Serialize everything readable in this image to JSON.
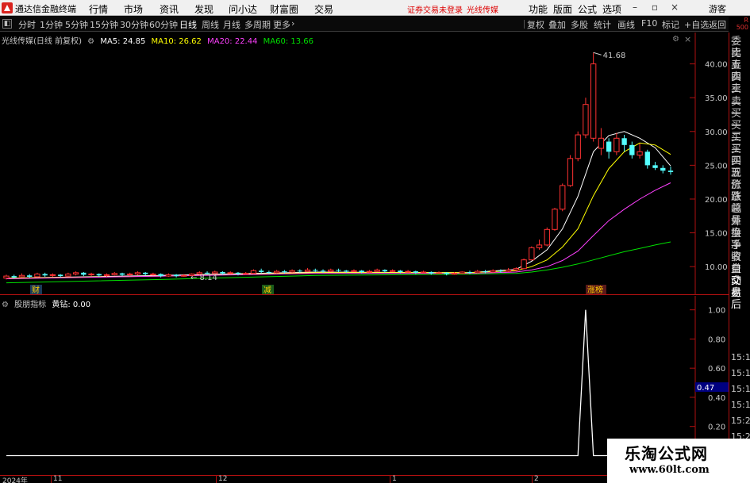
{
  "app": {
    "name": "通达信金融终端",
    "menus": [
      "行情",
      "市场",
      "资讯",
      "发现",
      "问小达",
      "财富圈",
      "交易"
    ],
    "notice": "证券交易未登录",
    "stock_tag": "光线传媒",
    "right_menus": [
      "功能",
      "版面",
      "公式",
      "选项"
    ],
    "guest": "游客"
  },
  "period_bar": {
    "periods": [
      "分时",
      "1分钟",
      "5分钟",
      "15分钟",
      "30分钟",
      "60分钟",
      "日线",
      "周线",
      "月线",
      "多周期",
      "更多"
    ],
    "active": "日线",
    "more_arrow": "›",
    "tools": [
      "复权",
      "叠加",
      "多股",
      "统计",
      "画线",
      "F10",
      "标记",
      "+自选",
      "返回"
    ]
  },
  "main_legend": {
    "title": "光线传媒(日线 前复权)",
    "ma5": "MA5: 24.85",
    "ma10": "MA10: 26.62",
    "ma20": "MA20: 22.44",
    "ma60": "MA60: 13.66",
    "colors": {
      "ma5": "#ffffff",
      "ma10": "#ffff00",
      "ma20": "#ff40ff",
      "ma60": "#00e000"
    }
  },
  "sub_legend": {
    "title": "股朋指标",
    "label": "黄钻: 0.00"
  },
  "chart_data": [
    {
      "type": "candlestick",
      "title": "光线传媒(日线 前复权)",
      "y_ticks": [
        "40.00",
        "35.00",
        "30.00",
        "25.00",
        "20.00",
        "15.00",
        "10.00"
      ],
      "ylim": [
        6.5,
        43
      ],
      "high_label": "41.68",
      "low_label": "8.14",
      "event_markers": [
        "财",
        "减",
        "涨榜"
      ],
      "candles": [
        {
          "o": 8.3,
          "c": 8.6,
          "h": 8.8,
          "l": 8.1
        },
        {
          "o": 8.6,
          "c": 8.4,
          "h": 8.8,
          "l": 8.2
        },
        {
          "o": 8.5,
          "c": 8.7,
          "h": 9.0,
          "l": 8.4
        },
        {
          "o": 8.7,
          "c": 8.5,
          "h": 8.9,
          "l": 8.3
        },
        {
          "o": 8.5,
          "c": 8.9,
          "h": 9.1,
          "l": 8.4
        },
        {
          "o": 8.9,
          "c": 8.7,
          "h": 9.1,
          "l": 8.5
        },
        {
          "o": 8.7,
          "c": 8.8,
          "h": 9.0,
          "l": 8.5
        },
        {
          "o": 8.8,
          "c": 8.6,
          "h": 8.9,
          "l": 8.4
        },
        {
          "o": 8.6,
          "c": 8.9,
          "h": 9.1,
          "l": 8.5
        },
        {
          "o": 8.9,
          "c": 9.1,
          "h": 9.3,
          "l": 8.7
        },
        {
          "o": 9.1,
          "c": 8.8,
          "h": 9.2,
          "l": 8.6
        },
        {
          "o": 8.8,
          "c": 8.9,
          "h": 9.1,
          "l": 8.6
        },
        {
          "o": 8.9,
          "c": 8.7,
          "h": 9.0,
          "l": 8.5
        },
        {
          "o": 8.7,
          "c": 8.8,
          "h": 9.0,
          "l": 8.5
        },
        {
          "o": 8.8,
          "c": 9.0,
          "h": 9.2,
          "l": 8.7
        },
        {
          "o": 9.0,
          "c": 8.8,
          "h": 9.1,
          "l": 8.6
        },
        {
          "o": 8.8,
          "c": 8.9,
          "h": 9.1,
          "l": 8.6
        },
        {
          "o": 8.9,
          "c": 9.1,
          "h": 9.3,
          "l": 8.7
        },
        {
          "o": 9.1,
          "c": 8.9,
          "h": 9.2,
          "l": 8.7
        },
        {
          "o": 8.9,
          "c": 8.9,
          "h": 9.1,
          "l": 8.7
        },
        {
          "o": 8.9,
          "c": 8.6,
          "h": 9.0,
          "l": 8.4
        },
        {
          "o": 8.6,
          "c": 8.8,
          "h": 9.0,
          "l": 8.5
        },
        {
          "o": 8.8,
          "c": 8.6,
          "h": 8.9,
          "l": 8.4
        },
        {
          "o": 8.6,
          "c": 8.7,
          "h": 8.9,
          "l": 8.5
        },
        {
          "o": 8.7,
          "c": 8.9,
          "h": 9.0,
          "l": 8.6
        },
        {
          "o": 8.9,
          "c": 9.1,
          "h": 9.3,
          "l": 8.8
        },
        {
          "o": 9.1,
          "c": 9.0,
          "h": 9.3,
          "l": 8.8
        },
        {
          "o": 9.0,
          "c": 9.2,
          "h": 9.4,
          "l": 8.9
        },
        {
          "o": 9.2,
          "c": 9.0,
          "h": 9.3,
          "l": 8.8
        },
        {
          "o": 9.0,
          "c": 9.1,
          "h": 9.3,
          "l": 8.9
        },
        {
          "o": 9.1,
          "c": 8.9,
          "h": 9.2,
          "l": 8.7
        },
        {
          "o": 8.9,
          "c": 9.0,
          "h": 9.2,
          "l": 8.8
        },
        {
          "o": 9.0,
          "c": 9.4,
          "h": 9.6,
          "l": 8.9
        },
        {
          "o": 9.4,
          "c": 9.2,
          "h": 9.7,
          "l": 9.0
        },
        {
          "o": 9.2,
          "c": 9.1,
          "h": 9.4,
          "l": 8.9
        },
        {
          "o": 9.1,
          "c": 9.3,
          "h": 9.5,
          "l": 9.0
        },
        {
          "o": 9.3,
          "c": 9.2,
          "h": 9.5,
          "l": 9.0
        },
        {
          "o": 9.2,
          "c": 9.4,
          "h": 9.6,
          "l": 9.1
        },
        {
          "o": 9.4,
          "c": 9.3,
          "h": 9.6,
          "l": 9.1
        },
        {
          "o": 9.3,
          "c": 9.5,
          "h": 9.8,
          "l": 9.2
        },
        {
          "o": 9.5,
          "c": 9.4,
          "h": 9.7,
          "l": 9.2
        },
        {
          "o": 9.4,
          "c": 9.3,
          "h": 9.6,
          "l": 9.1
        },
        {
          "o": 9.3,
          "c": 9.5,
          "h": 9.7,
          "l": 9.2
        },
        {
          "o": 9.5,
          "c": 9.4,
          "h": 9.7,
          "l": 9.2
        },
        {
          "o": 9.4,
          "c": 9.3,
          "h": 9.5,
          "l": 9.1
        },
        {
          "o": 9.3,
          "c": 9.4,
          "h": 9.6,
          "l": 9.2
        },
        {
          "o": 9.4,
          "c": 9.2,
          "h": 9.5,
          "l": 9.0
        },
        {
          "o": 9.2,
          "c": 9.3,
          "h": 9.5,
          "l": 9.1
        },
        {
          "o": 9.3,
          "c": 9.5,
          "h": 9.7,
          "l": 9.2
        },
        {
          "o": 9.5,
          "c": 9.3,
          "h": 9.6,
          "l": 9.1
        },
        {
          "o": 9.3,
          "c": 9.4,
          "h": 9.6,
          "l": 9.2
        },
        {
          "o": 9.4,
          "c": 9.2,
          "h": 9.5,
          "l": 9.0
        },
        {
          "o": 9.2,
          "c": 9.3,
          "h": 9.5,
          "l": 9.1
        },
        {
          "o": 9.3,
          "c": 9.1,
          "h": 9.4,
          "l": 8.9
        },
        {
          "o": 9.1,
          "c": 9.2,
          "h": 9.4,
          "l": 9.0
        },
        {
          "o": 9.2,
          "c": 9.0,
          "h": 9.3,
          "l": 8.8
        },
        {
          "o": 9.0,
          "c": 9.1,
          "h": 9.3,
          "l": 8.9
        },
        {
          "o": 9.1,
          "c": 8.9,
          "h": 9.2,
          "l": 8.7
        },
        {
          "o": 8.9,
          "c": 9.0,
          "h": 9.2,
          "l": 8.8
        },
        {
          "o": 9.0,
          "c": 9.2,
          "h": 9.3,
          "l": 8.9
        },
        {
          "o": 9.2,
          "c": 9.1,
          "h": 9.4,
          "l": 8.9
        },
        {
          "o": 9.1,
          "c": 9.3,
          "h": 9.5,
          "l": 9.0
        },
        {
          "o": 9.3,
          "c": 9.2,
          "h": 9.5,
          "l": 9.0
        },
        {
          "o": 9.2,
          "c": 9.4,
          "h": 9.6,
          "l": 9.1
        },
        {
          "o": 9.4,
          "c": 9.3,
          "h": 9.6,
          "l": 9.1
        },
        {
          "o": 9.3,
          "c": 9.5,
          "h": 9.8,
          "l": 9.2
        },
        {
          "o": 9.5,
          "c": 9.7,
          "h": 9.9,
          "l": 9.3
        },
        {
          "o": 9.7,
          "c": 11.0,
          "h": 11.2,
          "l": 9.6
        },
        {
          "o": 11.0,
          "c": 12.8,
          "h": 13.0,
          "l": 10.9
        },
        {
          "o": 12.8,
          "c": 13.2,
          "h": 14.0,
          "l": 12.5
        },
        {
          "o": 13.2,
          "c": 15.5,
          "h": 15.8,
          "l": 13.0
        },
        {
          "o": 15.5,
          "c": 18.5,
          "h": 18.7,
          "l": 15.3
        },
        {
          "o": 18.5,
          "c": 22.0,
          "h": 22.3,
          "l": 18.2
        },
        {
          "o": 22.0,
          "c": 26.0,
          "h": 26.5,
          "l": 21.8
        },
        {
          "o": 26.0,
          "c": 29.5,
          "h": 30.0,
          "l": 25.6
        },
        {
          "o": 29.5,
          "c": 34.0,
          "h": 35.0,
          "l": 29.0
        },
        {
          "o": 29.0,
          "c": 40.0,
          "h": 41.68,
          "l": 28.5
        },
        {
          "o": 27.5,
          "c": 29.0,
          "h": 30.5,
          "l": 26.5
        },
        {
          "o": 28.5,
          "c": 27.0,
          "h": 29.0,
          "l": 26.0
        },
        {
          "o": 27.0,
          "c": 29.0,
          "h": 29.8,
          "l": 26.5
        },
        {
          "o": 29.0,
          "c": 28.0,
          "h": 29.5,
          "l": 27.0
        },
        {
          "o": 28.0,
          "c": 26.5,
          "h": 28.5,
          "l": 26.0
        },
        {
          "o": 26.5,
          "c": 27.0,
          "h": 28.2,
          "l": 26.0
        },
        {
          "o": 27.0,
          "c": 25.0,
          "h": 27.3,
          "l": 24.5
        },
        {
          "o": 25.0,
          "c": 24.6,
          "h": 25.5,
          "l": 24.3
        },
        {
          "o": 24.6,
          "c": 24.2,
          "h": 25.0,
          "l": 23.8
        },
        {
          "o": 24.2,
          "c": 24.0,
          "h": 24.8,
          "l": 23.6
        }
      ],
      "ma_series": [
        {
          "name": "MA5",
          "color": "#ffffff",
          "points": [
            [
              0,
              8.3
            ],
            [
              20,
              8.7
            ],
            [
              40,
              9.2
            ],
            [
              60,
              9.1
            ],
            [
              66,
              9.6
            ],
            [
              68,
              10.8
            ],
            [
              70,
              12.5
            ],
            [
              72,
              15.6
            ],
            [
              74,
              20.4
            ],
            [
              76,
              27.0
            ],
            [
              78,
              29.4
            ],
            [
              80,
              30.0
            ],
            [
              82,
              29.0
            ],
            [
              84,
              27.6
            ],
            [
              86,
              24.9
            ]
          ]
        },
        {
          "name": "MA10",
          "color": "#ffff00",
          "points": [
            [
              0,
              8.3
            ],
            [
              20,
              8.6
            ],
            [
              40,
              9.1
            ],
            [
              60,
              9.1
            ],
            [
              66,
              9.4
            ],
            [
              68,
              10.0
            ],
            [
              70,
              11.0
            ],
            [
              72,
              12.9
            ],
            [
              74,
              15.6
            ],
            [
              76,
              20.5
            ],
            [
              78,
              24.5
            ],
            [
              80,
              27.0
            ],
            [
              82,
              28.3
            ],
            [
              84,
              28.0
            ],
            [
              86,
              26.6
            ]
          ]
        },
        {
          "name": "MA20",
          "color": "#ff40ff",
          "points": [
            [
              0,
              8.2
            ],
            [
              20,
              8.6
            ],
            [
              40,
              9.0
            ],
            [
              60,
              9.0
            ],
            [
              66,
              9.2
            ],
            [
              68,
              9.5
            ],
            [
              70,
              10.0
            ],
            [
              72,
              10.9
            ],
            [
              74,
              12.3
            ],
            [
              76,
              14.6
            ],
            [
              78,
              16.8
            ],
            [
              80,
              18.5
            ],
            [
              82,
              20.0
            ],
            [
              84,
              21.3
            ],
            [
              86,
              22.4
            ]
          ]
        },
        {
          "name": "MA60",
          "color": "#00e000",
          "points": [
            [
              0,
              7.6
            ],
            [
              20,
              8.1
            ],
            [
              40,
              8.7
            ],
            [
              60,
              8.9
            ],
            [
              66,
              9.0
            ],
            [
              68,
              9.2
            ],
            [
              70,
              9.5
            ],
            [
              72,
              9.9
            ],
            [
              74,
              10.4
            ],
            [
              76,
              11.0
            ],
            [
              78,
              11.6
            ],
            [
              80,
              12.2
            ],
            [
              82,
              12.7
            ],
            [
              84,
              13.2
            ],
            [
              86,
              13.66
            ]
          ]
        }
      ]
    },
    {
      "type": "line",
      "title": "股朋指标",
      "series": [
        {
          "name": "黄钻",
          "values": [
            [
              0,
              0
            ],
            [
              74,
              0
            ],
            [
              75,
              1
            ],
            [
              76,
              0
            ],
            [
              86,
              0
            ]
          ]
        }
      ],
      "y_ticks": [
        "1.00",
        "0.80",
        "0.60",
        "0.40",
        "0.20"
      ],
      "ylim": [
        -0.09,
        1.02
      ],
      "current_value": "0.47"
    }
  ],
  "right_panel": {
    "top_mark": [
      "R",
      "500"
    ],
    "labels": [
      "委比",
      "卖五",
      "卖四",
      "卖三",
      "卖二",
      "卖一",
      "买一",
      "买二",
      "买三",
      "买四",
      "买五",
      "现价",
      "涨跌",
      "涨幅",
      "总量",
      "外盘",
      "换手",
      "净资",
      "收益",
      "自动",
      "交易",
      "盘后"
    ],
    "times": [
      "15:12",
      "15:13",
      "15:14",
      "15:17",
      "15:20",
      "15:22",
      "15:23"
    ]
  },
  "date_axis": {
    "labels": [
      "2024年",
      "11",
      "12",
      "1",
      "2"
    ]
  },
  "watermark": {
    "title": "乐淘公式网",
    "url": "www.60lt.com"
  }
}
